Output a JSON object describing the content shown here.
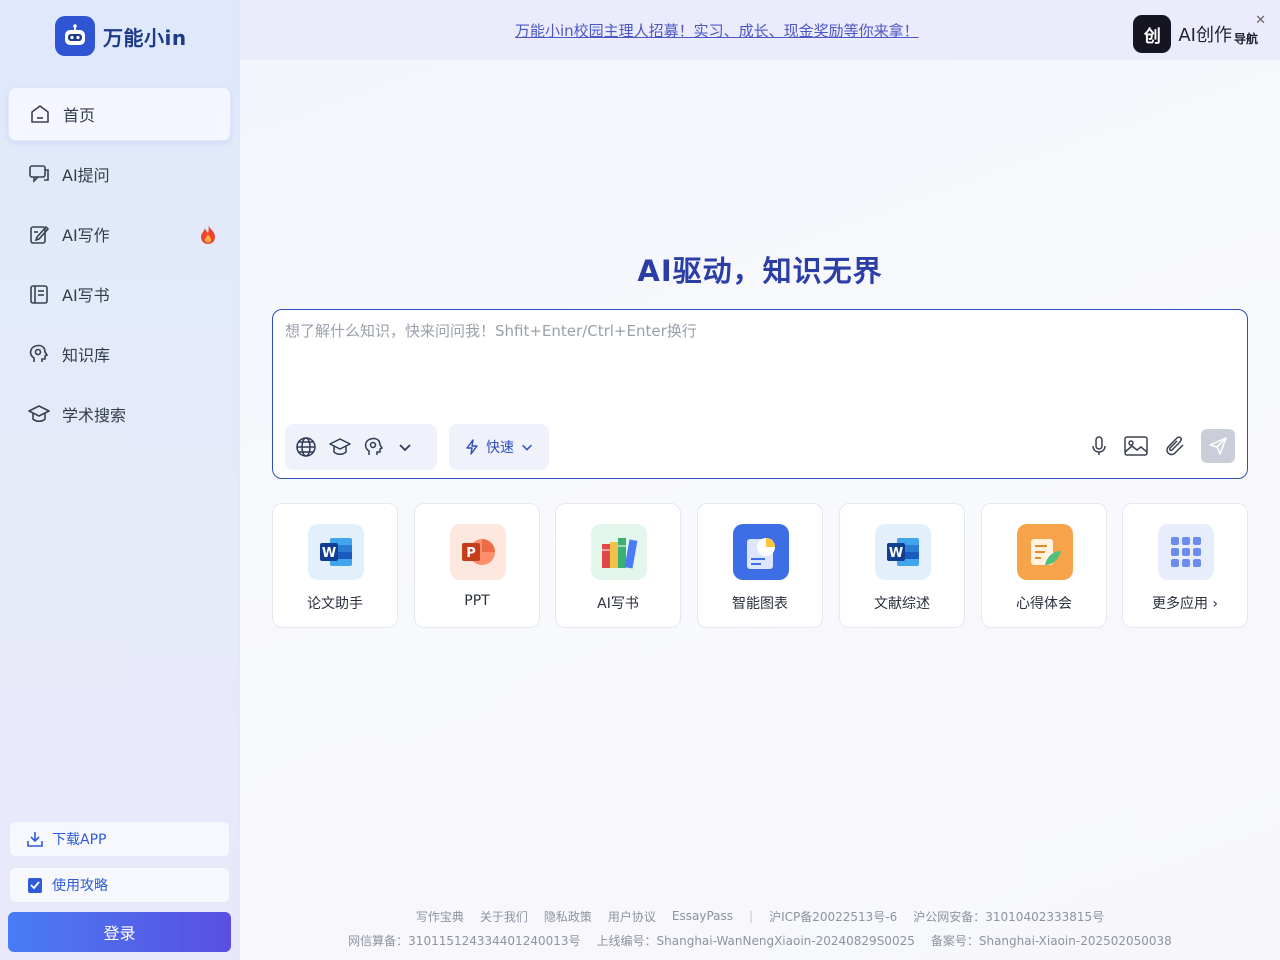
{
  "brand": {
    "name": "万能小in"
  },
  "sidebar": {
    "items": [
      {
        "label": "首页",
        "icon": "home-icon",
        "active": true
      },
      {
        "label": "AI提问",
        "icon": "chat-icon"
      },
      {
        "label": "AI写作",
        "icon": "edit-icon",
        "hot": true
      },
      {
        "label": "AI写书",
        "icon": "book-icon"
      },
      {
        "label": "知识库",
        "icon": "knowledge-icon"
      },
      {
        "label": "学术搜索",
        "icon": "graduation-cap-icon"
      }
    ],
    "download_label": "下载APP",
    "guide_label": "使用攻略",
    "login_label": "登录"
  },
  "banner": {
    "text": "万能小in校园主理人招募！实习、成长、现金奖励等你来拿！",
    "ad_icon_text": "创",
    "ad_text": "AI创作",
    "ad_small": "导航",
    "close": "✕"
  },
  "hero": {
    "title": "AI驱动，知识无界"
  },
  "composer": {
    "placeholder": "想了解什么知识，快来问问我！Shfit+Enter/Ctrl+Enter换行",
    "mode_label": "快速"
  },
  "apps": [
    {
      "label": "论文助手",
      "icon": "word-icon"
    },
    {
      "label": "PPT",
      "icon": "ppt-icon"
    },
    {
      "label": "AI写书",
      "icon": "books-icon"
    },
    {
      "label": "智能图表",
      "icon": "chart-icon"
    },
    {
      "label": "文献综述",
      "icon": "word-icon"
    },
    {
      "label": "心得体会",
      "icon": "notes-icon"
    },
    {
      "label": "更多应用 ›",
      "icon": "grid-icon"
    }
  ],
  "footer": {
    "links": [
      "写作宝典",
      "关于我们",
      "隐私政策",
      "用户协议",
      "EssayPass"
    ],
    "icp": "沪ICP备20022513号-6",
    "police": "沪公网安备：31010402333815号",
    "net": "网信算备：310115124334401240013号",
    "online": "上线编号：Shanghai-WanNengXiaoin-20240829S0025",
    "record": "备案号：Shanghai-Xiaoin-202502050038"
  },
  "colors": {
    "accent": "#2f4fbf",
    "title": "#2b3ea6",
    "login_start": "#4a7cf7",
    "login_end": "#5a4fe0"
  }
}
